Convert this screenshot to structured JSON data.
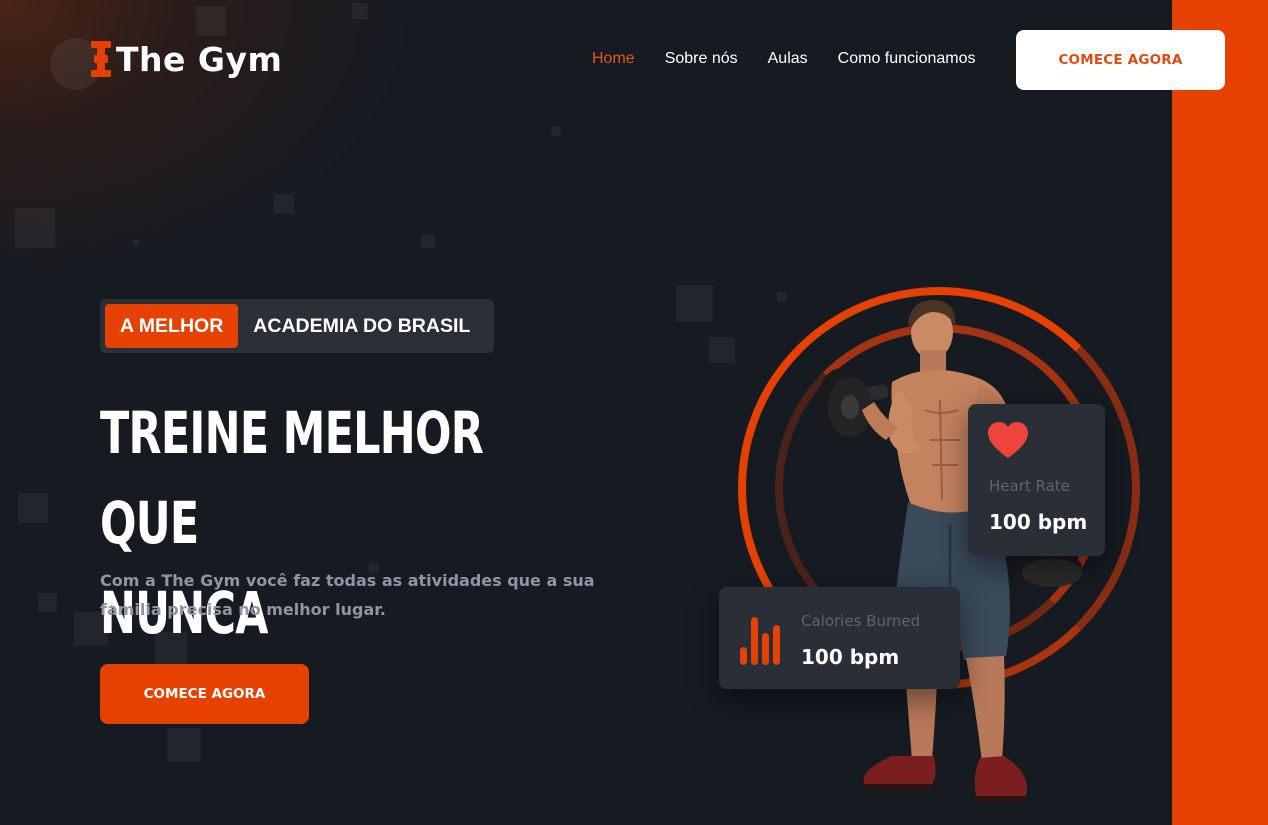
{
  "brand": {
    "name": "The Gym",
    "icon": "dumbbell-icon",
    "accent": "#e64100"
  },
  "nav": {
    "items": [
      {
        "label": "Home",
        "active": true
      },
      {
        "label": "Sobre nós",
        "active": false
      },
      {
        "label": "Aulas",
        "active": false
      },
      {
        "label": "Como funcionamos",
        "active": false
      }
    ],
    "cta_label": "COMECE AGORA"
  },
  "hero": {
    "badge_highlight": "A MELHOR",
    "badge_text": "ACADEMIA DO BRASIL",
    "title_line1": "TREINE MELHOR QUE",
    "title_line2": "NUNCA",
    "description": "Com a The Gym você faz todas as atividades que a sua familia precisa no melhor lugar.",
    "cta_label": "COMECE AGORA"
  },
  "stats": {
    "heart_rate": {
      "icon": "heart-icon",
      "label": "Heart Rate",
      "value": "100 bpm"
    },
    "calories": {
      "icon": "bar-chart-icon",
      "label": "Calories Burned",
      "value": "100 bpm"
    }
  }
}
